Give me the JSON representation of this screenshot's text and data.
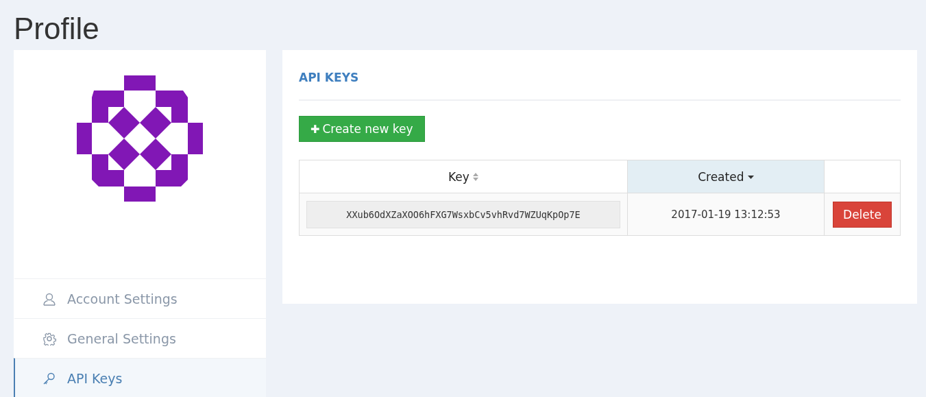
{
  "page": {
    "title": "Profile"
  },
  "sidebar": {
    "items": [
      {
        "label": "Account Settings",
        "kind": "user",
        "selected": false
      },
      {
        "label": "General Settings",
        "kind": "gear",
        "selected": false
      },
      {
        "label": "API Keys",
        "kind": "key",
        "selected": true
      }
    ]
  },
  "panel": {
    "heading": "API KEYS",
    "create_button": {
      "icon": "✚",
      "label": "Create new key"
    },
    "table": {
      "columns": [
        {
          "label": "Key",
          "sortable": true,
          "sorted": false
        },
        {
          "label": "Created",
          "sortable": true,
          "sorted": true
        }
      ],
      "rows": [
        {
          "key": "XXub6OdXZaXOO6hFXG7WsxbCv5vhRvd7WZUqKpOp7E",
          "created": "2017-01-19 13:12:53",
          "action": "Delete"
        }
      ]
    }
  }
}
